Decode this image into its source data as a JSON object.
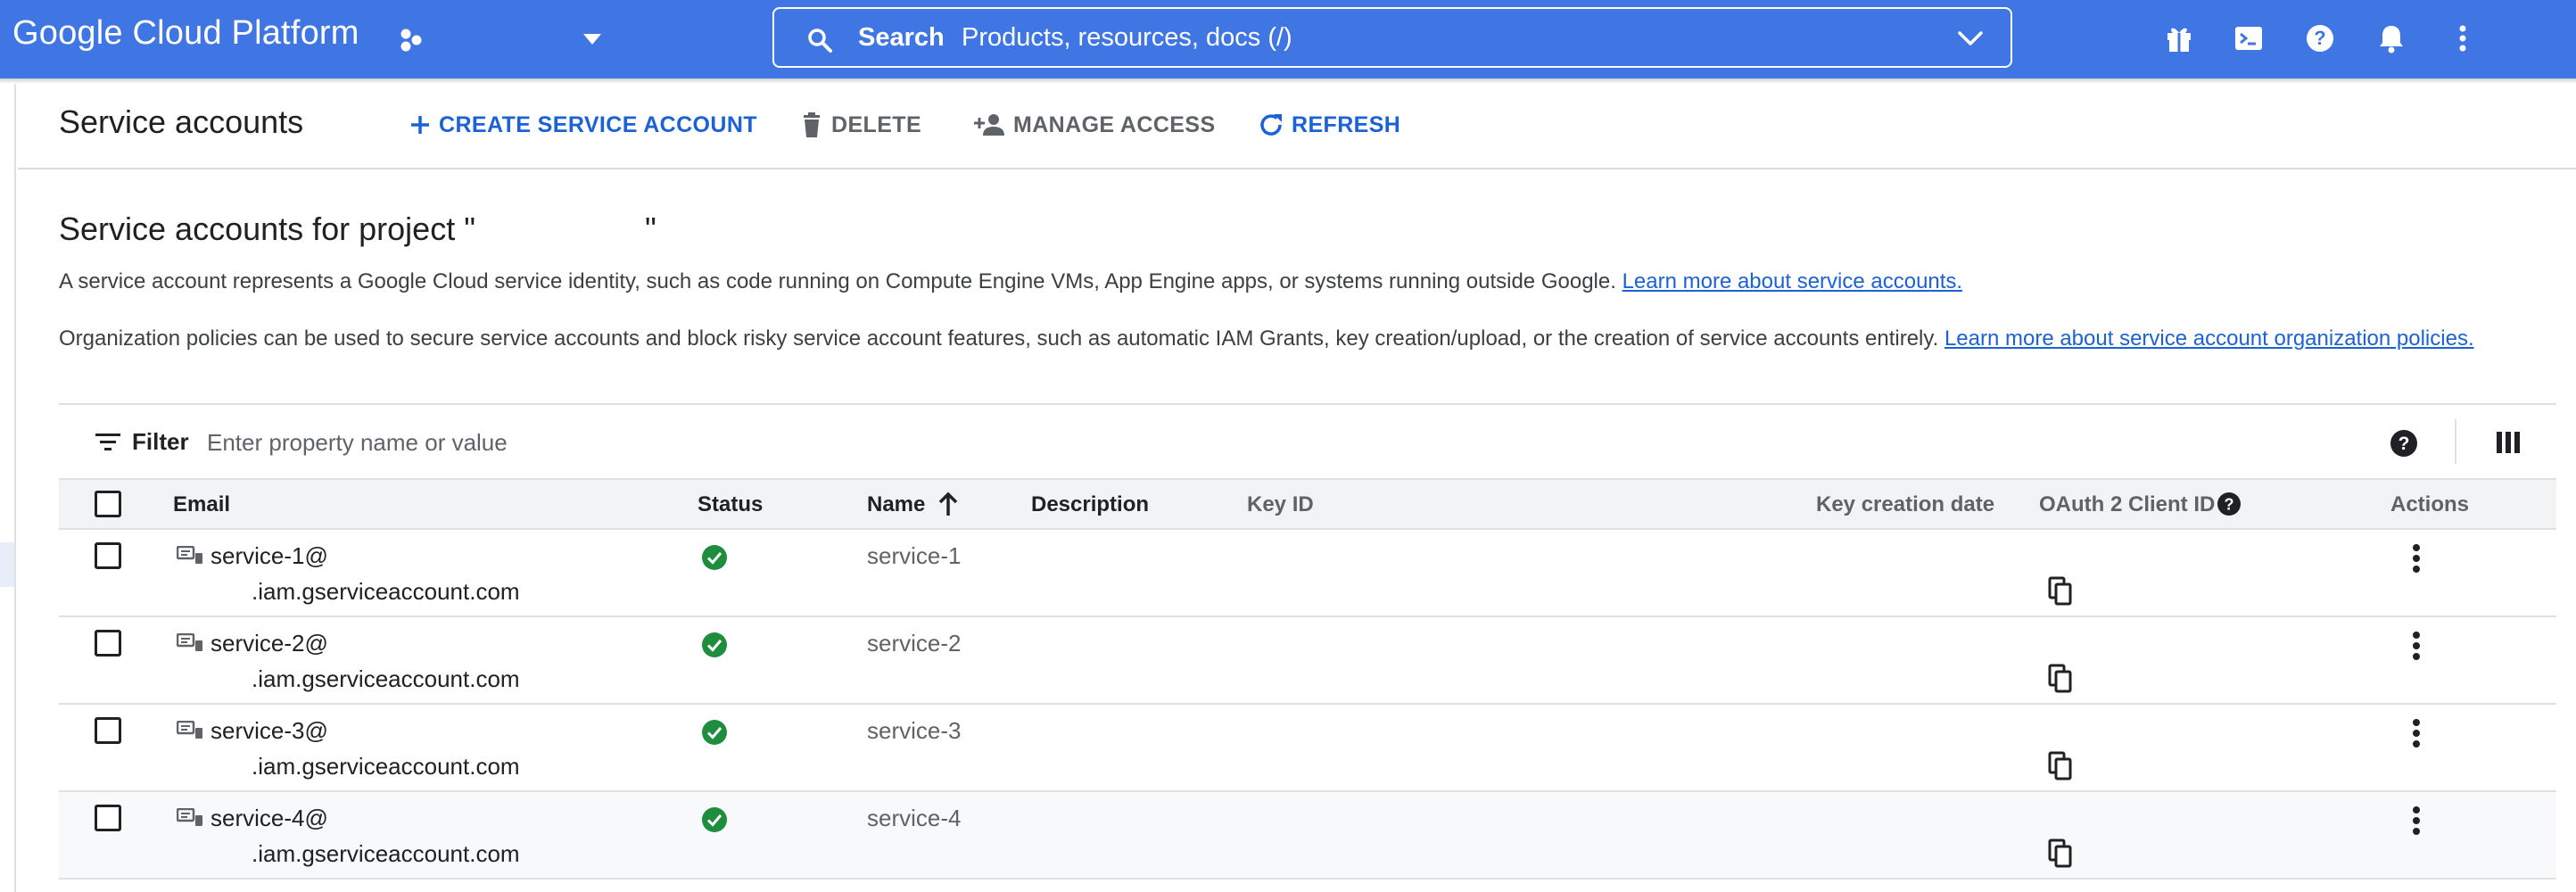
{
  "header": {
    "brand": "Google Cloud Platform",
    "search": {
      "label": "Search",
      "placeholder": "Products, resources, docs (/)"
    },
    "icons": [
      "gift-icon",
      "cloud-shell-icon",
      "help-icon",
      "notifications-icon",
      "more-vert-icon"
    ]
  },
  "actionbar": {
    "title": "Service accounts",
    "create_label": "CREATE SERVICE ACCOUNT",
    "delete_label": "DELETE",
    "manage_access_label": "MANAGE ACCESS",
    "refresh_label": "REFRESH"
  },
  "content": {
    "section_title_prefix": "Service accounts for project \"",
    "section_title_suffix": "\"",
    "desc1": "A service account represents a Google Cloud service identity, such as code running on Compute Engine VMs, App Engine apps, or systems running outside Google.",
    "desc1_link": "Learn more about service accounts.",
    "desc2": "Organization policies can be used to secure service accounts and block risky service account features, such as automatic IAM Grants, key creation/upload, or the creation of service accounts entirely.",
    "desc2_link": "Learn more about service account organization policies."
  },
  "filter": {
    "label": "Filter",
    "placeholder": "Enter property name or value"
  },
  "table": {
    "headers": {
      "email": "Email",
      "status": "Status",
      "name": "Name",
      "description": "Description",
      "key_id": "Key ID",
      "key_creation_date": "Key creation date",
      "oauth_client_id": "OAuth 2 Client ID",
      "actions": "Actions"
    },
    "sort": {
      "column": "name",
      "direction": "ascending"
    },
    "rows": [
      {
        "email_line1": "service-1@",
        "email_line2": ".iam.gserviceaccount.com",
        "status": "enabled",
        "name": "service-1"
      },
      {
        "email_line1": "service-2@",
        "email_line2": ".iam.gserviceaccount.com",
        "status": "enabled",
        "name": "service-2"
      },
      {
        "email_line1": "service-3@",
        "email_line2": ".iam.gserviceaccount.com",
        "status": "enabled",
        "name": "service-3"
      },
      {
        "email_line1": "service-4@",
        "email_line2": ".iam.gserviceaccount.com",
        "status": "enabled",
        "name": "service-4"
      }
    ]
  },
  "colors": {
    "topbar": "#3f76e4",
    "accent": "#1a62d6",
    "success": "#1e8e3e",
    "text_muted": "#5f6368"
  }
}
